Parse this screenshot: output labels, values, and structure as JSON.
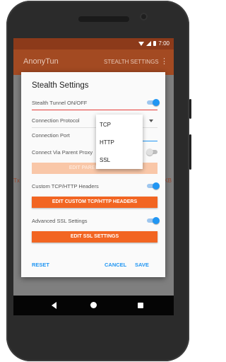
{
  "status_bar": {
    "time": "7:00",
    "icons": [
      "wifi-icon",
      "signal-icon",
      "battery-icon"
    ]
  },
  "app_bar": {
    "title": "AnonyTun",
    "action": "STEALTH SETTINGS",
    "more_icon": "more-vert-icon"
  },
  "background": {
    "left_fragment": "Tx",
    "right_fragment": "KB"
  },
  "dialog": {
    "title": "Stealth Settings",
    "stealth_tunnel": {
      "label": "Stealth Tunnel ON/OFF",
      "enabled": true
    },
    "connection_protocol": {
      "label": "Connection Protocol"
    },
    "connection_port": {
      "label": "Connection Port"
    },
    "parent_proxy": {
      "label": "Connect Via Parent Proxy",
      "enabled": false,
      "button": "EDIT PARENT PROXY"
    },
    "custom_headers": {
      "label": "Custom TCP/HTTP Headers",
      "enabled": true,
      "button": "EDIT CUSTOM TCP/HTTP HEADERS"
    },
    "advanced_ssl": {
      "label": "Advanced SSL Settings",
      "enabled": true,
      "button": "EDIT SSL SETTINGS"
    },
    "footer": {
      "reset": "RESET",
      "cancel": "CANCEL",
      "save": "SAVE"
    }
  },
  "protocol_dropdown": {
    "options": [
      "TCP",
      "HTTP",
      "SSL"
    ]
  },
  "colors": {
    "accent": "#2196f3",
    "primary_button": "#f26522",
    "app_bar": "#a34a22"
  }
}
